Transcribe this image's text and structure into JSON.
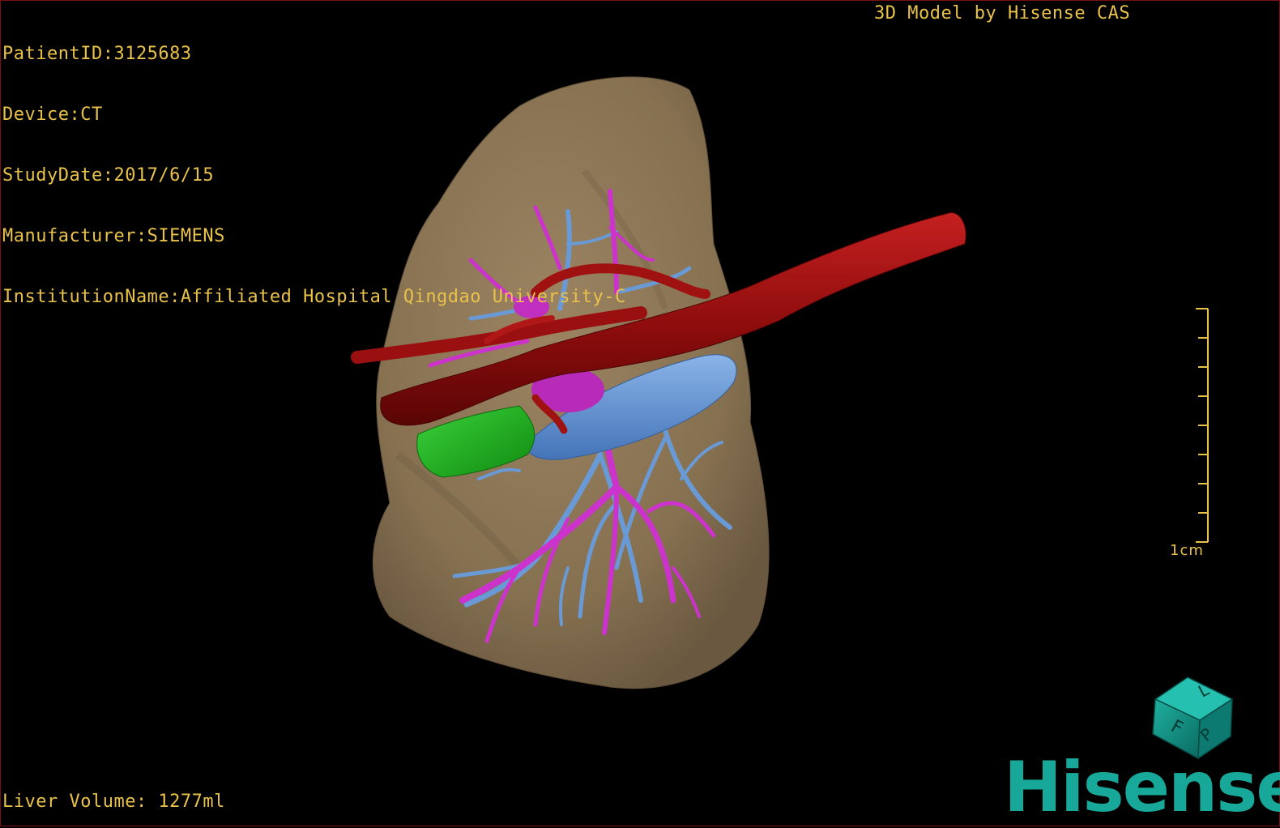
{
  "viewer": {
    "brand_title": "3D Model by Hisense CAS",
    "patient_info": [
      "PatientID:3125683",
      "Device:CT",
      "StudyDate:2017/6/15",
      "Manufacturer:SIEMENS",
      "InstitutionName:Affiliated Hospital Qingdao University-C"
    ],
    "volume_label": "Liver Volume: 1277ml",
    "scale_bar_label": "1cm",
    "orientation_cube_faces": [
      "F",
      "L",
      "P"
    ],
    "logo_text": "Hisense"
  },
  "colors": {
    "text": "#e8c24a",
    "liver": "#8b7454",
    "hepatic_artery": "#9a1010",
    "portal_vein": "#cc33cc",
    "hepatic_vein": "#5b8fd0",
    "gallbladder": "#1fb01f",
    "logo": "#17a899"
  },
  "icons": {
    "orientation_cube": "orientation-cube-icon"
  }
}
